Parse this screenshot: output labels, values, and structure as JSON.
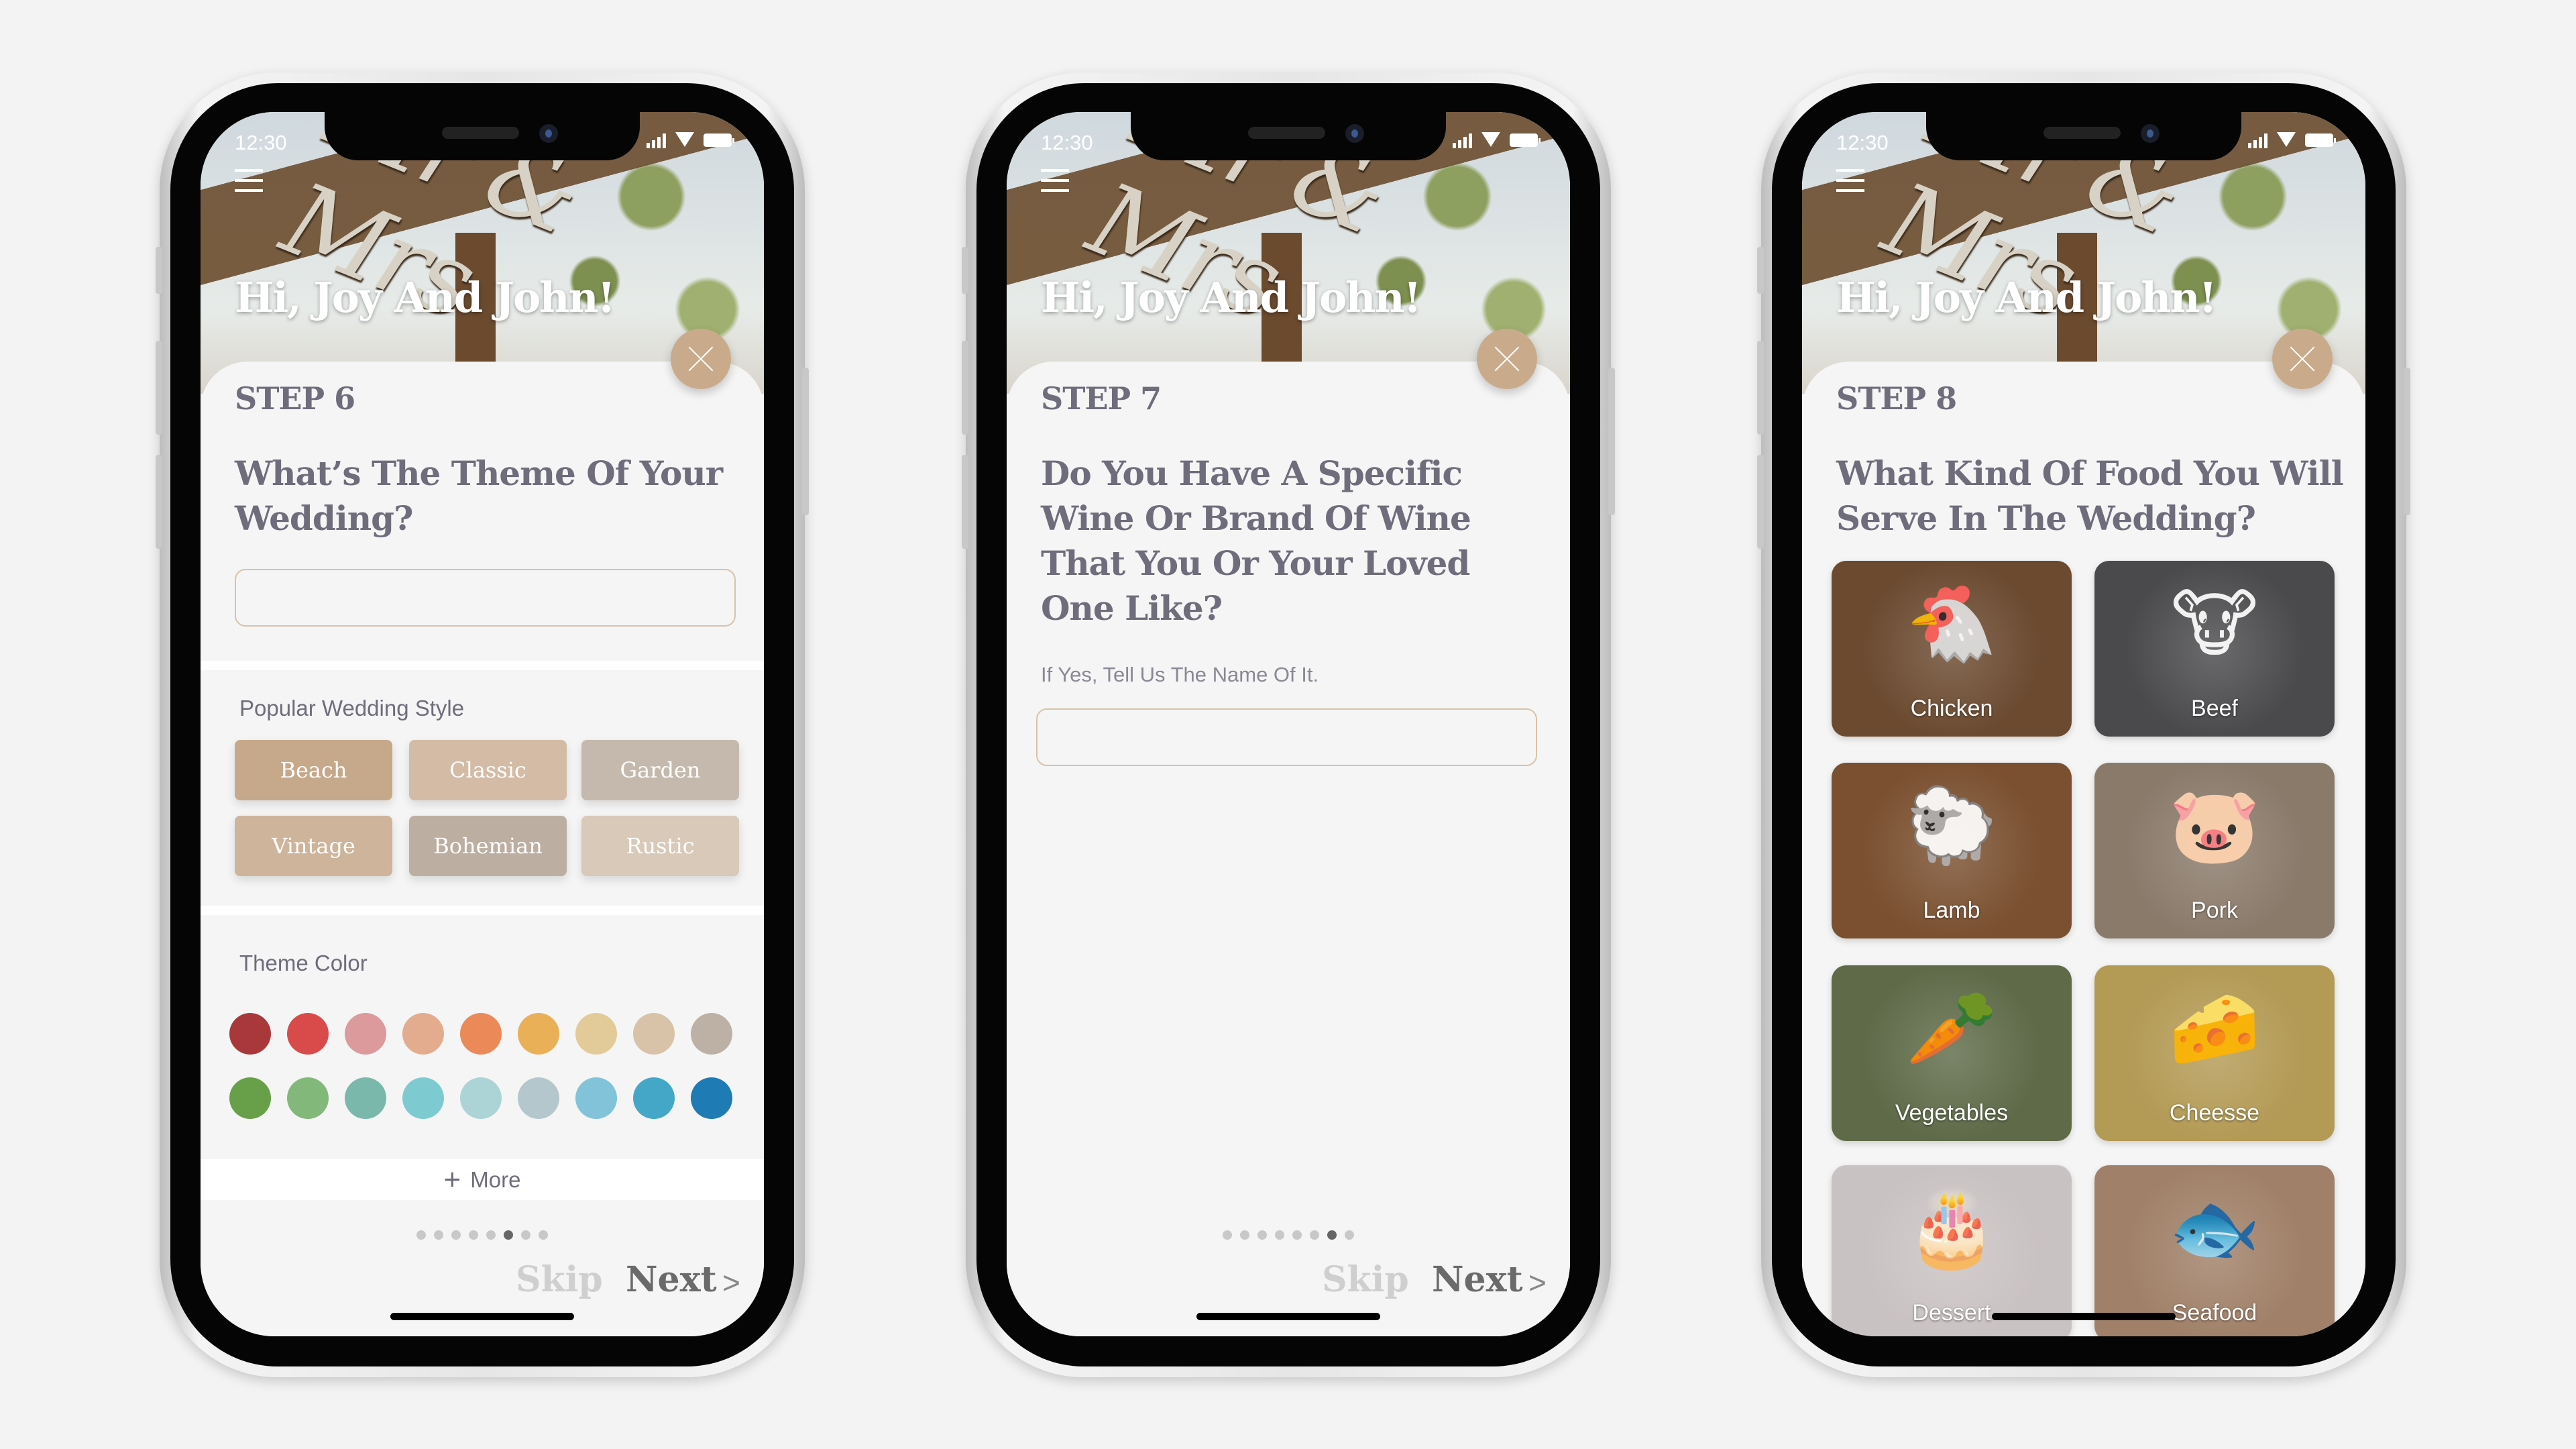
{
  "status_bar": {
    "time": "12:30"
  },
  "header": {
    "greeting": "Hi, Joy And John!",
    "sign_text": "Mr & Mrs"
  },
  "colors": {
    "accent": "#c9ab8c",
    "text": "#6f6c7c",
    "input_border": "#d9c2a8",
    "background": "#f3f3f3"
  },
  "screens": [
    {
      "step": "STEP 6",
      "question": "What’s The Theme Of Your Wedding?",
      "answer_value": "",
      "styles_label": "Popular Wedding Style",
      "styles": [
        {
          "label": "Beach",
          "color": "#c6a88a"
        },
        {
          "label": "Classic",
          "color": "#d3bba5"
        },
        {
          "label": "Garden",
          "color": "#c5b9ad"
        },
        {
          "label": "Vintage",
          "color": "#cdb49a"
        },
        {
          "label": "Bohemian",
          "color": "#bcafa2"
        },
        {
          "label": "Rustic",
          "color": "#d9c9b8"
        }
      ],
      "theme_color_label": "Theme Color",
      "theme_colors": [
        "#a9383a",
        "#d94b4b",
        "#dc9a9c",
        "#e3ac8e",
        "#eb8a58",
        "#e9b058",
        "#e2cb98",
        "#d8c2a8",
        "#bdb1a5",
        "#67a048",
        "#82b87a",
        "#79b8ab",
        "#7dcbd0",
        "#acd4d6",
        "#b4c7cd",
        "#82c3da",
        "#44a7c8",
        "#1f7bb3"
      ],
      "more_label": "More",
      "pagination": {
        "total": 8,
        "current": 6
      },
      "skip_label": "Skip",
      "next_label": "Next"
    },
    {
      "step": "STEP 7",
      "question": "Do You Have A Specific Wine Or Brand Of Wine That You Or Your Loved One Like?",
      "hint": "If Yes, Tell Us The Name Of It.",
      "answer_value": "",
      "pagination": {
        "total": 8,
        "current": 7
      },
      "skip_label": "Skip",
      "next_label": "Next"
    },
    {
      "step": "STEP 8",
      "question": "What Kind Of Food You Will Serve In The Wedding?",
      "food_options": [
        {
          "label": "Chicken",
          "icon": "chicken-icon",
          "glyph": "🐔",
          "bg": "#6b4a30"
        },
        {
          "label": "Beef",
          "icon": "cow-icon",
          "glyph": "🐮",
          "bg": "#4a4a4c"
        },
        {
          "label": "Lamb",
          "icon": "sheep-icon",
          "glyph": "🐑",
          "bg": "#7a5030"
        },
        {
          "label": "Pork",
          "icon": "pig-icon",
          "glyph": "🐷",
          "bg": "#8a7a6a"
        },
        {
          "label": "Vegetables",
          "icon": "carrot-icon",
          "glyph": "🥕",
          "bg": "#5e6a48"
        },
        {
          "label": "Cheesse",
          "icon": "cheese-icon",
          "glyph": "🧀",
          "bg": "#b39a55"
        },
        {
          "label": "Dessert",
          "icon": "cake-icon",
          "glyph": "🎂",
          "bg": "#c9c2c2"
        },
        {
          "label": "Seafood",
          "icon": "fish-icon",
          "glyph": "🐟",
          "bg": "#a08068"
        }
      ]
    }
  ]
}
